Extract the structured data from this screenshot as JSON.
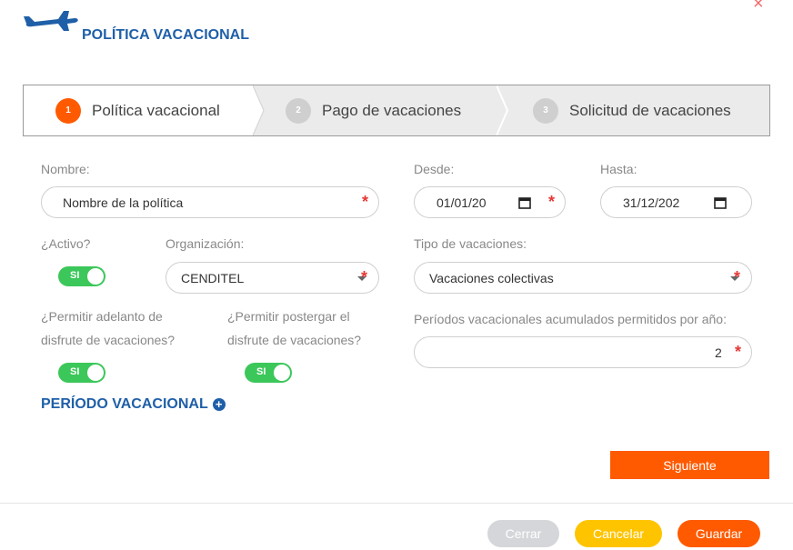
{
  "header": {
    "title": "POLÍTICA VACACIONAL",
    "close_glyph": "×",
    "logo_icon": "airplane-icon"
  },
  "stepper": {
    "steps": [
      {
        "number": "1",
        "label": "Política vacacional"
      },
      {
        "number": "2",
        "label": "Pago de vacaciones"
      },
      {
        "number": "3",
        "label": "Solicitud de vacaciones"
      }
    ]
  },
  "form": {
    "nombre": {
      "label": "Nombre:",
      "placeholder": "Nombre de la política"
    },
    "desde": {
      "label": "Desde:",
      "value": "01/01/20"
    },
    "hasta": {
      "label": "Hasta:",
      "value": "31/12/202"
    },
    "activo": {
      "label": "¿Activo?",
      "toggle": "SI"
    },
    "organizacion": {
      "label": "Organización:",
      "value": "CENDITEL"
    },
    "tipo_vacaciones": {
      "label": "Tipo de vacaciones:",
      "value": "Vacaciones colectivas"
    },
    "adelanto": {
      "label_line1": "¿Permitir adelanto de",
      "label_line2": "disfrute de vacaciones?",
      "toggle": "SI"
    },
    "postergar": {
      "label_line1": "¿Permitir postergar el",
      "label_line2": "disfrute de vacaciones?",
      "toggle": "SI"
    },
    "periodos": {
      "label": "Períodos vacacionales acumulados permitidos por año:",
      "value": "2"
    },
    "required_mark": "*"
  },
  "section": {
    "periodo_label": "PERÍODO VACACIONAL",
    "plus_glyph": "+"
  },
  "actions": {
    "next_label": "Siguiente",
    "close_label": "Cerrar",
    "cancel_label": "Cancelar",
    "save_label": "Guardar"
  },
  "colors": {
    "accent": "#ff5a00",
    "brand_blue": "#1f5fa8",
    "toggle_on": "#3cc75a",
    "cancel": "#ffc400",
    "disabled": "#d4d6d9"
  }
}
